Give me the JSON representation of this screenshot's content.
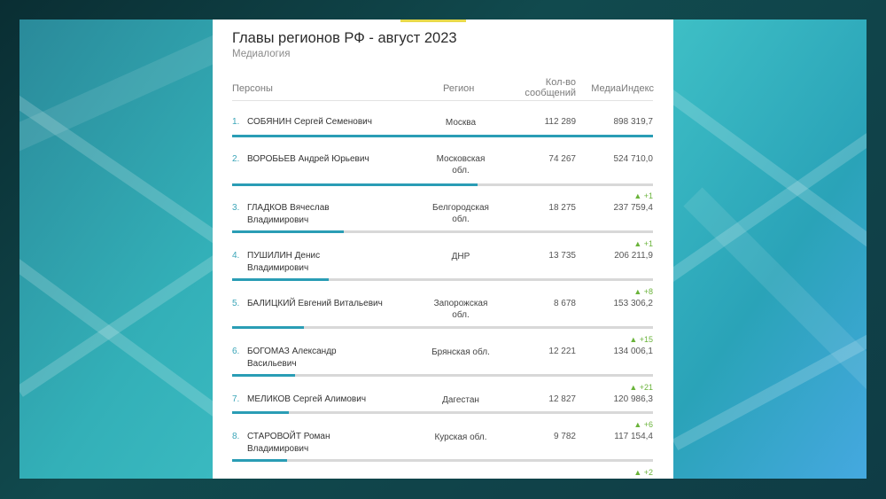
{
  "title": "Главы регионов РФ - август 2023",
  "subtitle": "Медиалогия",
  "headers": {
    "person": "Персоны",
    "region": "Регион",
    "messages_line1": "Кол-во",
    "messages_line2": "сообщений",
    "index": "МедиаИндекс"
  },
  "colors": {
    "accent": "#e8d94a",
    "bar": "#2a9db5",
    "rank_number": "#3aa5b8",
    "change_up": "#6ab33a"
  },
  "rows": [
    {
      "rank": "1.",
      "name_line1": "СОБЯНИН Сергей Семенович",
      "name_line2": "",
      "region_line1": "Москва",
      "region_line2": "",
      "messages": "112 289",
      "index": "898 319,7",
      "change": "",
      "bar_fraction": 1.0
    },
    {
      "rank": "2.",
      "name_line1": "ВОРОБЬЕВ Андрей Юрьевич",
      "name_line2": "",
      "region_line1": "Московская",
      "region_line2": "обл.",
      "messages": "74 267",
      "index": "524 710,0",
      "change": "",
      "bar_fraction": 0.584
    },
    {
      "rank": "3.",
      "name_line1": "ГЛАДКОВ Вячеслав",
      "name_line2": "Владимирович",
      "region_line1": "Белгородская",
      "region_line2": "обл.",
      "messages": "18 275",
      "index": "237 759,4",
      "change": "▲ +1",
      "bar_fraction": 0.265
    },
    {
      "rank": "4.",
      "name_line1": "ПУШИЛИН Денис",
      "name_line2": "Владимирович",
      "region_line1": "ДНР",
      "region_line2": "",
      "messages": "13 735",
      "index": "206 211,9",
      "change": "▲ +1",
      "bar_fraction": 0.23
    },
    {
      "rank": "5.",
      "name_line1": "БАЛИЦКИЙ Евгений Витальевич",
      "name_line2": "",
      "region_line1": "Запорожская",
      "region_line2": "обл.",
      "messages": "8 678",
      "index": "153 306,2",
      "change": "▲ +8",
      "bar_fraction": 0.171
    },
    {
      "rank": "6.",
      "name_line1": "БОГОМАЗ Александр",
      "name_line2": "Васильевич",
      "region_line1": "Брянская обл.",
      "region_line2": "",
      "messages": "12 221",
      "index": "134 006,1",
      "change": "▲ +15",
      "bar_fraction": 0.149
    },
    {
      "rank": "7.",
      "name_line1": "МЕЛИКОВ Сергей Алимович",
      "name_line2": "",
      "region_line1": "Дагестан",
      "region_line2": "",
      "messages": "12 827",
      "index": "120 986,3",
      "change": "▲ +21",
      "bar_fraction": 0.135
    },
    {
      "rank": "8.",
      "name_line1": "СТАРОВОЙТ Роман",
      "name_line2": "Владимирович",
      "region_line1": "Курская обл.",
      "region_line2": "",
      "messages": "9 782",
      "index": "117 154,4",
      "change": "▲ +6",
      "bar_fraction": 0.13
    },
    {
      "rank": "",
      "name_line1": "",
      "name_line2": "",
      "region_line1": "",
      "region_line2": "",
      "messages": "",
      "index": "",
      "change": "▲ +2",
      "bar_fraction": 0
    }
  ]
}
